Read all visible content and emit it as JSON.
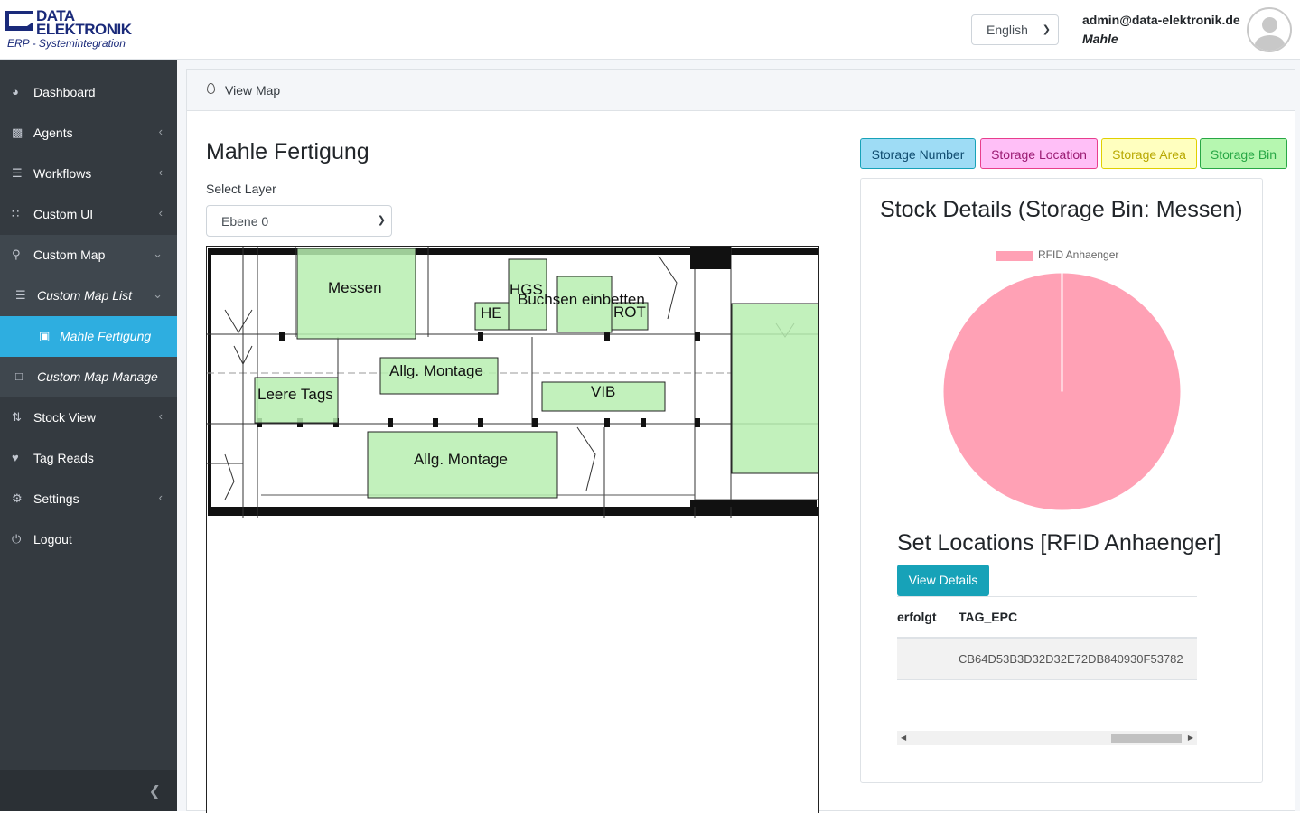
{
  "header": {
    "logo": {
      "line1": "DATA",
      "line2": "ELEKTRONIK",
      "line3": "ERP - Systemintegration"
    },
    "language": {
      "value": "English"
    },
    "user": {
      "email": "admin@data-elektronik.de",
      "org": "Mahle"
    }
  },
  "sidebar": {
    "items": [
      {
        "label": "Dashboard",
        "icon": "dashboard-icon"
      },
      {
        "label": "Agents",
        "icon": "chart-icon"
      },
      {
        "label": "Workflows",
        "icon": "list-icon"
      },
      {
        "label": "Custom UI",
        "icon": "grid-icon"
      },
      {
        "label": "Custom Map",
        "icon": "map-marker-icon"
      },
      {
        "label": "Custom Map List",
        "icon": "list-icon"
      },
      {
        "label": "Mahle Fertigung",
        "icon": "file-code-icon"
      },
      {
        "label": "Custom Map Manage",
        "icon": "square-icon"
      },
      {
        "label": "Stock View",
        "icon": "stock-icon"
      },
      {
        "label": "Tag Reads",
        "icon": "heartbeat-icon"
      },
      {
        "label": "Settings",
        "icon": "cogs-icon"
      },
      {
        "label": "Logout",
        "icon": "power-icon"
      }
    ]
  },
  "breadcrumb": {
    "title": "View Map"
  },
  "page": {
    "title": "Mahle Fertigung",
    "layer_label": "Select Layer",
    "layer_value": "Ebene 0"
  },
  "legend": {
    "storage_number": "Storage Number",
    "storage_location": "Storage Location",
    "storage_area": "Storage Area",
    "storage_bin": "Storage Bin"
  },
  "map": {
    "zones": [
      "Messen",
      "HGS",
      "HE",
      "Buchsen einbetten",
      "ROT",
      "Allg. Montage",
      "Leere Tags",
      "VIB",
      "Allg. Montage"
    ]
  },
  "details": {
    "title": "Stock Details (Storage Bin: Messen)",
    "set_title": "Set Locations [RFID Anhaenger]",
    "view_button": "View Details",
    "columns": [
      "erfolgt",
      "TAG_EPC"
    ],
    "rows": [
      {
        "erfolgt": "",
        "tag_epc": "CB64D53B3D32D32E72DB840930F53782"
      }
    ]
  },
  "chart_data": {
    "type": "pie",
    "categories": [
      "RFID Anhaenger"
    ],
    "values": [
      1
    ],
    "colors": [
      "#ffa1b5"
    ],
    "legend": "top"
  }
}
